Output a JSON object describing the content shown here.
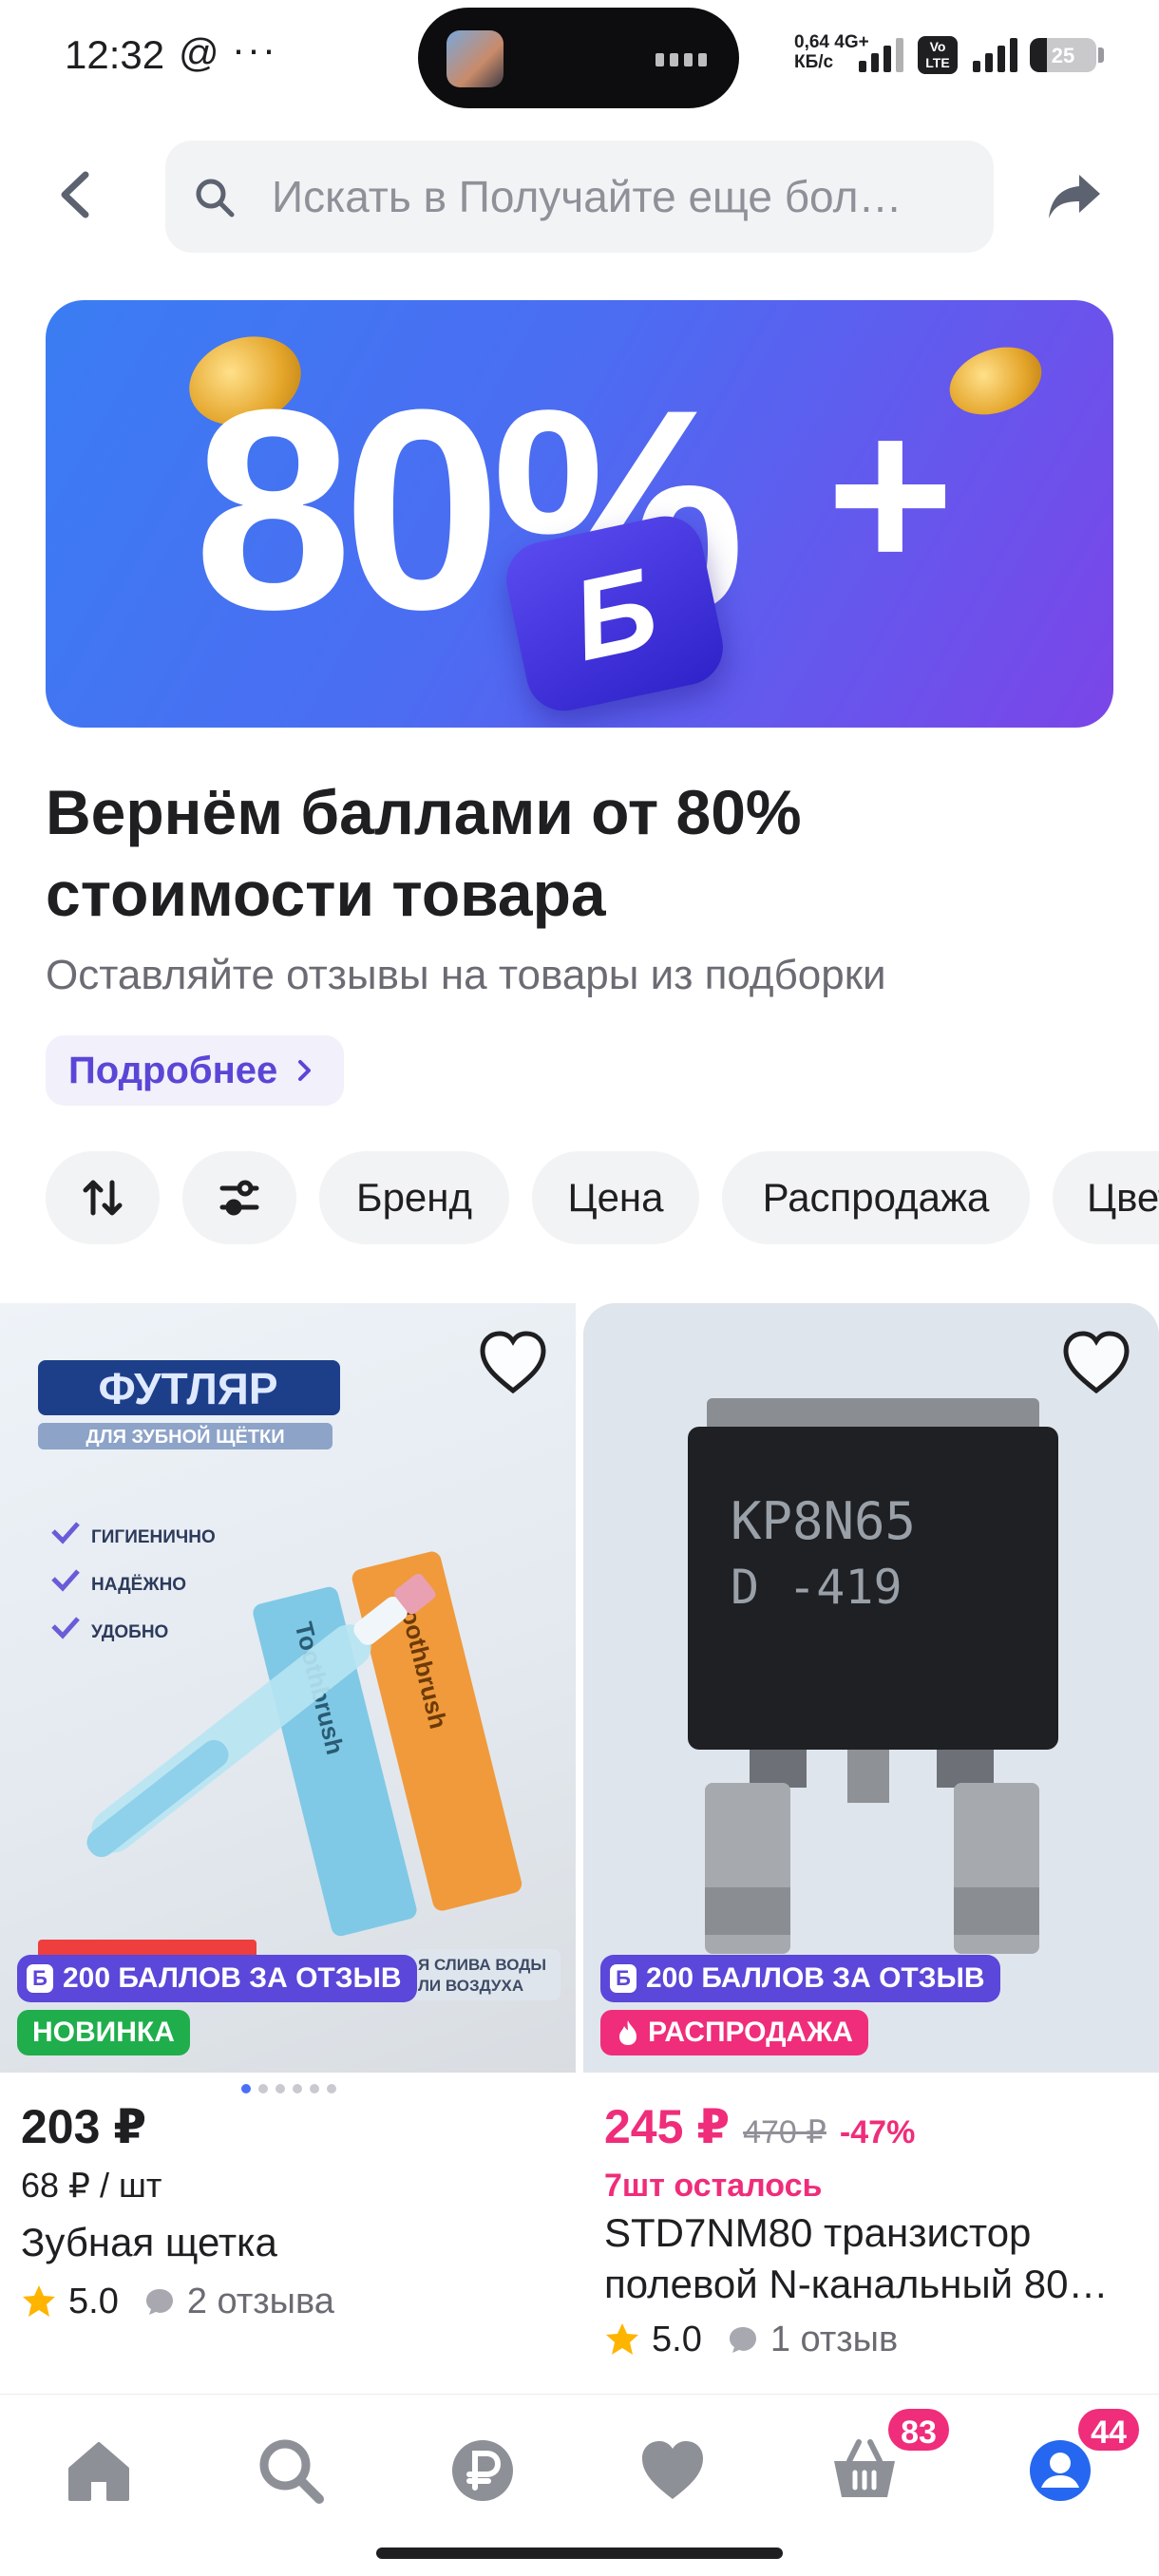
{
  "status_bar": {
    "time": "12:32",
    "at_icon": "@",
    "more": "···",
    "network_speed_value": "0,64",
    "network_type": "4G+",
    "network_speed_unit": "КБ/с",
    "volte": "Vo LTE",
    "battery": "25"
  },
  "header": {
    "search_placeholder": "Искать в Получайте еще бол…",
    "back_icon": "arrow-left-icon",
    "share_icon": "share-icon"
  },
  "banner": {
    "big_text": "80%",
    "plus": "+",
    "cube_letter": "Б"
  },
  "promo": {
    "title": "Вернём баллами от 80% стоимости товара",
    "subtitle": "Оставляйте отзывы на товары из подборки",
    "more_label": "Подробнее"
  },
  "filters": {
    "items": [
      "Бренд",
      "Цена",
      "Распродажа",
      "Цвет"
    ]
  },
  "products": [
    {
      "points_badge": "200 БАЛЛОВ ЗА ОТЗЫВ",
      "tag": "НОВИНКА",
      "tag_color": "#1fae4b",
      "price": "203 ₽",
      "unit_price": "68 ₽ / шт",
      "title": "Зубная щетка",
      "rating": "5.0",
      "reviews": "2 отзыва",
      "image_text": {
        "title": "ФУТЛЯР",
        "subtitle": "ДЛЯ ЗУБНОЙ ЩЁТКИ",
        "benefits": [
          "ГИГИЕНИЧНО",
          "НАДЁЖНО",
          "УДОБНО"
        ],
        "brush_label": "Toothbrush",
        "footer_a": "Я СЛИВА ВОДЫ",
        "footer_b": "ЛИ ВОЗДУХА"
      }
    },
    {
      "points_badge": "200 БАЛЛОВ ЗА ОТЗЫВ",
      "tag": "РАСПРОДАЖА",
      "tag_color": "#ef2d7a",
      "price": "245 ₽",
      "old_price": "470 ₽",
      "discount": "-47%",
      "stock": "7шт осталось",
      "title": "STD7NM80 транзистор полевой N-канальный 80…",
      "rating": "5.0",
      "reviews": "1 отзыв",
      "image_text": {
        "chip_line1": "KP8N65",
        "chip_line2": "D  -419"
      }
    }
  ],
  "bottom_nav": {
    "items": [
      "home-icon",
      "search-icon",
      "ruble-icon",
      "heart-icon",
      "cart-icon",
      "profile-icon"
    ],
    "cart_badge": "83",
    "profile_badge": "44"
  },
  "colors": {
    "accent": "#5b47d9",
    "pink": "#ef2d7a",
    "blue": "#2567f0"
  }
}
